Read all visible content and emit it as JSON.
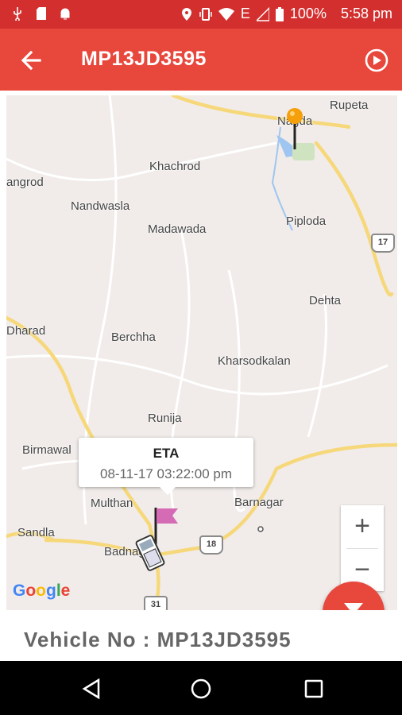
{
  "status_bar": {
    "battery": "100%",
    "time": "5:58 pm",
    "network": "E",
    "icons": [
      "usb-icon",
      "sdcard-icon",
      "android-icon",
      "location-icon",
      "vibrate-icon",
      "wifi-icon",
      "signal-icon",
      "battery-icon"
    ]
  },
  "app_bar": {
    "title": "MP13JD3595",
    "back_icon": "arrow-left-icon",
    "play_icon": "play-circle-icon"
  },
  "map": {
    "labels": [
      "Rupeta",
      "Nagda",
      "Khachrod",
      "angrod",
      "Nandwasla",
      "Madawada",
      "Piploda",
      "Dehta",
      "Dharad",
      "Berchha",
      "Kharsodkalan",
      "Runija",
      "Birmawal",
      "Multhan",
      "Barnagar",
      "Sandla",
      "Badnagar"
    ],
    "road_shields": [
      "17",
      "18",
      "31"
    ],
    "eta_popup": {
      "title": "ETA",
      "time": "08-11-17 03:22:00 pm"
    },
    "zoom_in": "+",
    "zoom_out": "−",
    "attribution": "Google"
  },
  "info": {
    "vehicle_label": "Vehicle No : MP13JD3595"
  },
  "colors": {
    "accent": "#e8473c",
    "status_bar": "#d32f2f",
    "map_bg": "#f1ecea",
    "road_major": "#f6d87a",
    "road_minor": "#ffffff",
    "water": "#9ec6f0",
    "flag": "#d56ab5"
  }
}
